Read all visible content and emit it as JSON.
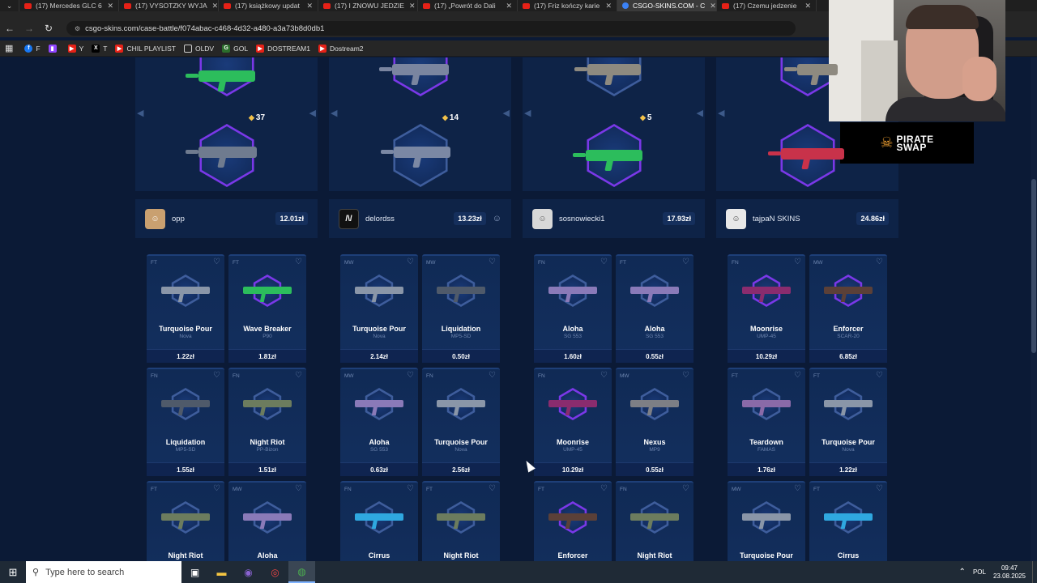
{
  "browser": {
    "tabs": [
      {
        "label": "(17) Mercedes GLC 6",
        "active": false
      },
      {
        "label": "(17) VYSOTZKY WYJA",
        "active": false
      },
      {
        "label": "(17) książkowy updat",
        "active": false
      },
      {
        "label": "(17) I ZNOWU JEDZIE",
        "active": false
      },
      {
        "label": "(17) „Powrót do Dali",
        "active": false
      },
      {
        "label": "(17) Friz kończy karie",
        "active": false
      },
      {
        "label": "CSGO-SKINS.COM - C",
        "active": true
      },
      {
        "label": "(17) Czemu jedzenie",
        "active": false
      }
    ],
    "url": "csgo-skins.com/case-battle/f074abac-c468-4d32-a480-a3a73b8d0db1",
    "bookmarks": [
      "F",
      "",
      "Y",
      "T",
      "CHIL PLAYLIST",
      "OLDV",
      "GOL",
      "DOSTREAM1",
      "Dostream2"
    ]
  },
  "top_cases": [
    {
      "count": "37"
    },
    {
      "count": "14"
    },
    {
      "count": "5"
    },
    {
      "count": ""
    }
  ],
  "players": [
    {
      "name": "opp",
      "total": "12.01zł",
      "items": [
        {
          "wear": "FT",
          "name": "Turquoise Pour",
          "sub": "Nova",
          "price": "1.22zł"
        },
        {
          "wear": "FT",
          "name": "Wave Breaker",
          "sub": "P90",
          "price": "1.81zł"
        },
        {
          "wear": "FN",
          "name": "Liquidation",
          "sub": "MP5-SD",
          "price": "1.55zł"
        },
        {
          "wear": "FN",
          "name": "Night Riot",
          "sub": "PP-Bizon",
          "price": "1.51zł"
        },
        {
          "wear": "FT",
          "name": "Night Riot",
          "sub": "",
          "price": ""
        },
        {
          "wear": "MW",
          "name": "Aloha",
          "sub": "",
          "price": ""
        }
      ]
    },
    {
      "name": "delordss",
      "total": "13.23zł",
      "items": [
        {
          "wear": "MW",
          "name": "Turquoise Pour",
          "sub": "Nova",
          "price": "2.14zł"
        },
        {
          "wear": "MW",
          "name": "Liquidation",
          "sub": "MP5-SD",
          "price": "0.50zł"
        },
        {
          "wear": "MW",
          "name": "Aloha",
          "sub": "SG 553",
          "price": "0.63zł"
        },
        {
          "wear": "FN",
          "name": "Turquoise Pour",
          "sub": "Nova",
          "price": "2.56zł"
        },
        {
          "wear": "FN",
          "name": "Cirrus",
          "sub": "",
          "price": ""
        },
        {
          "wear": "FT",
          "name": "Night Riot",
          "sub": "",
          "price": ""
        }
      ]
    },
    {
      "name": "sosnowiecki1",
      "total": "17.93zł",
      "items": [
        {
          "wear": "FN",
          "name": "Aloha",
          "sub": "SG 553",
          "price": "1.60zł"
        },
        {
          "wear": "FT",
          "name": "Aloha",
          "sub": "SG 553",
          "price": "0.55zł"
        },
        {
          "wear": "FN",
          "name": "Moonrise",
          "sub": "UMP-45",
          "price": "10.29zł"
        },
        {
          "wear": "MW",
          "name": "Nexus",
          "sub": "MP9",
          "price": "0.55zł"
        },
        {
          "wear": "FT",
          "name": "Enforcer",
          "sub": "",
          "price": ""
        },
        {
          "wear": "FN",
          "name": "Night Riot",
          "sub": "",
          "price": ""
        }
      ]
    },
    {
      "name": "tajpaN SKINS",
      "total": "24.86zł",
      "items": [
        {
          "wear": "FN",
          "name": "Moonrise",
          "sub": "UMP-45",
          "price": "10.29zł"
        },
        {
          "wear": "MW",
          "name": "Enforcer",
          "sub": "SCAR-20",
          "price": "6.85zł"
        },
        {
          "wear": "FT",
          "name": "Teardown",
          "sub": "FAMAS",
          "price": "1.76zł"
        },
        {
          "wear": "FT",
          "name": "Turquoise Pour",
          "sub": "Nova",
          "price": "1.22zł"
        },
        {
          "wear": "MW",
          "name": "Turquoise Pour",
          "sub": "",
          "price": ""
        },
        {
          "wear": "FT",
          "name": "Cirrus",
          "sub": "",
          "price": ""
        }
      ]
    }
  ],
  "overlay": {
    "logo_text_1": "PIRATE",
    "logo_text_2": "SWAP"
  },
  "taskbar": {
    "search_placeholder": "Type here to search",
    "language": "POL",
    "time": "09:47",
    "date": "23.08.2025"
  },
  "colors": {
    "page_bg": "#0b1a36",
    "panel_bg": "#0e2347",
    "hex_border": "#7a38e8",
    "coin": "#f3c24a"
  },
  "icons": [
    "back-icon",
    "forward-icon",
    "reload-icon",
    "heart-icon",
    "coin-icon",
    "windows-icon",
    "search-icon",
    "task-view-icon",
    "folder-icon",
    "chrome-icon"
  ]
}
